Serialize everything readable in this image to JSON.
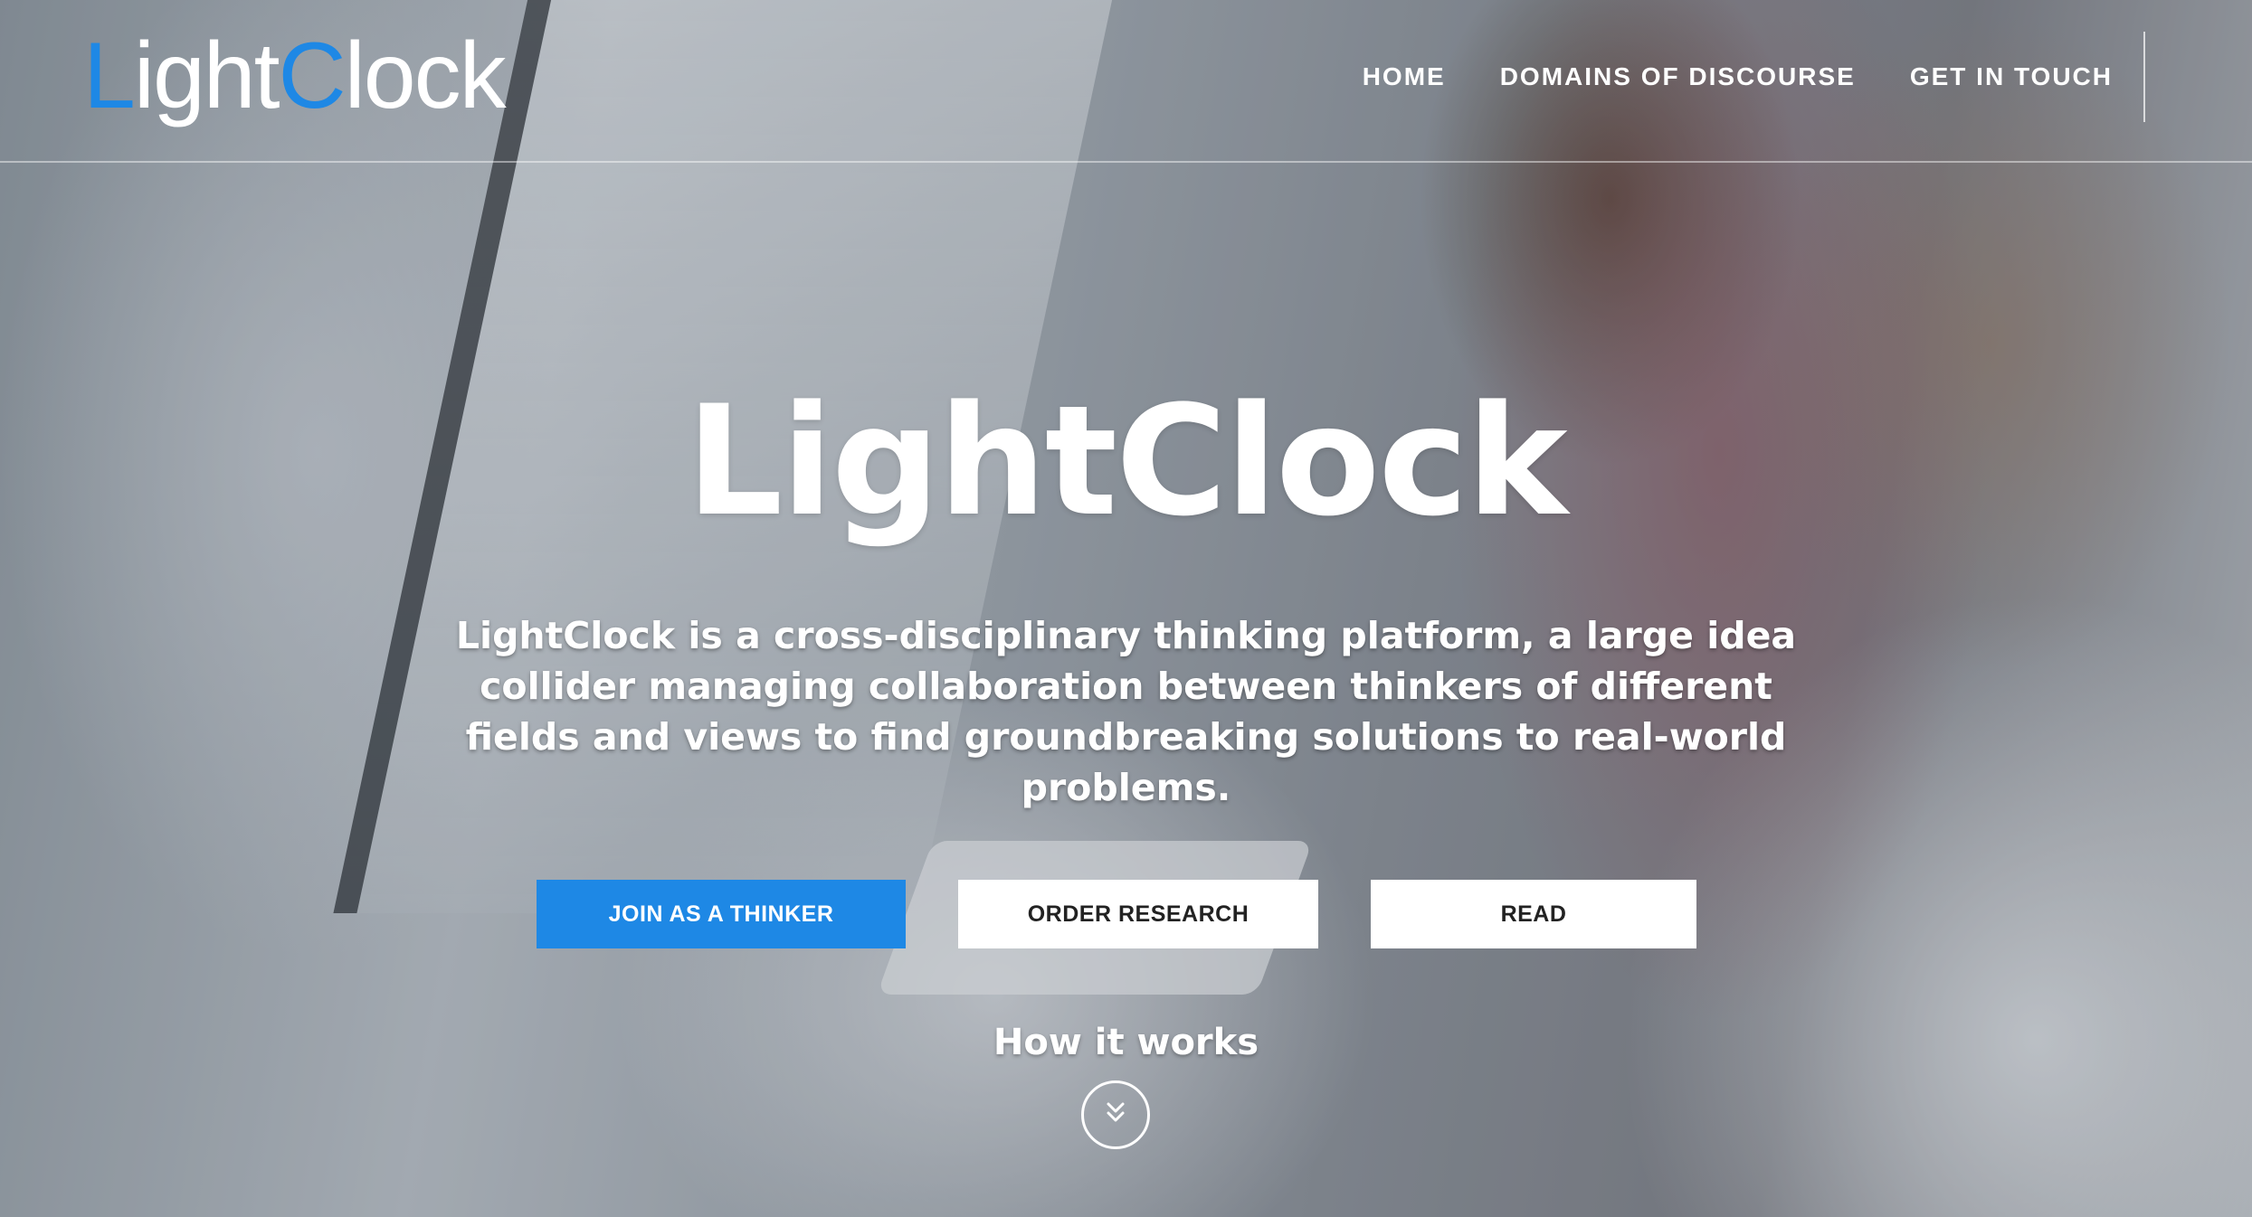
{
  "header": {
    "logo": {
      "part1": "L",
      "part2": "ight",
      "part3": "C",
      "part4": "lock"
    },
    "nav": [
      {
        "label": "HOME"
      },
      {
        "label": "DOMAINS OF DISCOURSE"
      },
      {
        "label": "GET IN TOUCH"
      }
    ]
  },
  "hero": {
    "title": "LightClock",
    "description": "LightClock is a cross-disciplinary thinking platform, a large idea collider managing collaboration between thinkers of different fields and views to find groundbreaking solutions to real-world problems.",
    "buttons": {
      "join": "JOIN AS A THINKER",
      "order": "ORDER RESEARCH",
      "read": "READ"
    },
    "how_it_works": "How it works",
    "scroll_icon": "double-chevron-down-icon"
  },
  "colors": {
    "accent": "#1e88e5",
    "text": "#ffffff",
    "button_secondary_bg": "#ffffff",
    "button_secondary_text": "#222222"
  }
}
